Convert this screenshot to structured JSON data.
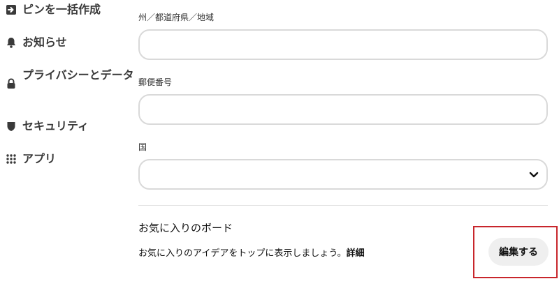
{
  "sidebar": {
    "items": [
      {
        "label": "ピンを一括作成",
        "icon": "import-arrow-icon"
      },
      {
        "label": "お知らせ",
        "icon": "bell-icon"
      },
      {
        "label": "プライバシーとデータ",
        "icon": "lock-icon"
      },
      {
        "label": "セキュリティ",
        "icon": "shield-icon"
      },
      {
        "label": "アプリ",
        "icon": "apps-grid-icon"
      }
    ]
  },
  "form": {
    "state_label": "州／都道府県／地域",
    "state_value": "",
    "postal_label": "郵便番号",
    "postal_value": "",
    "country_label": "国",
    "country_value": ""
  },
  "favorites": {
    "title": "お気に入りのボード",
    "description": "お気に入りのアイデアをトップに表示しましょう。",
    "detail_link": "詳細",
    "edit_button": "編集する"
  },
  "colors": {
    "highlight": "#c8262c",
    "button_bg": "#efefef",
    "input_border": "#d9d9d9"
  }
}
